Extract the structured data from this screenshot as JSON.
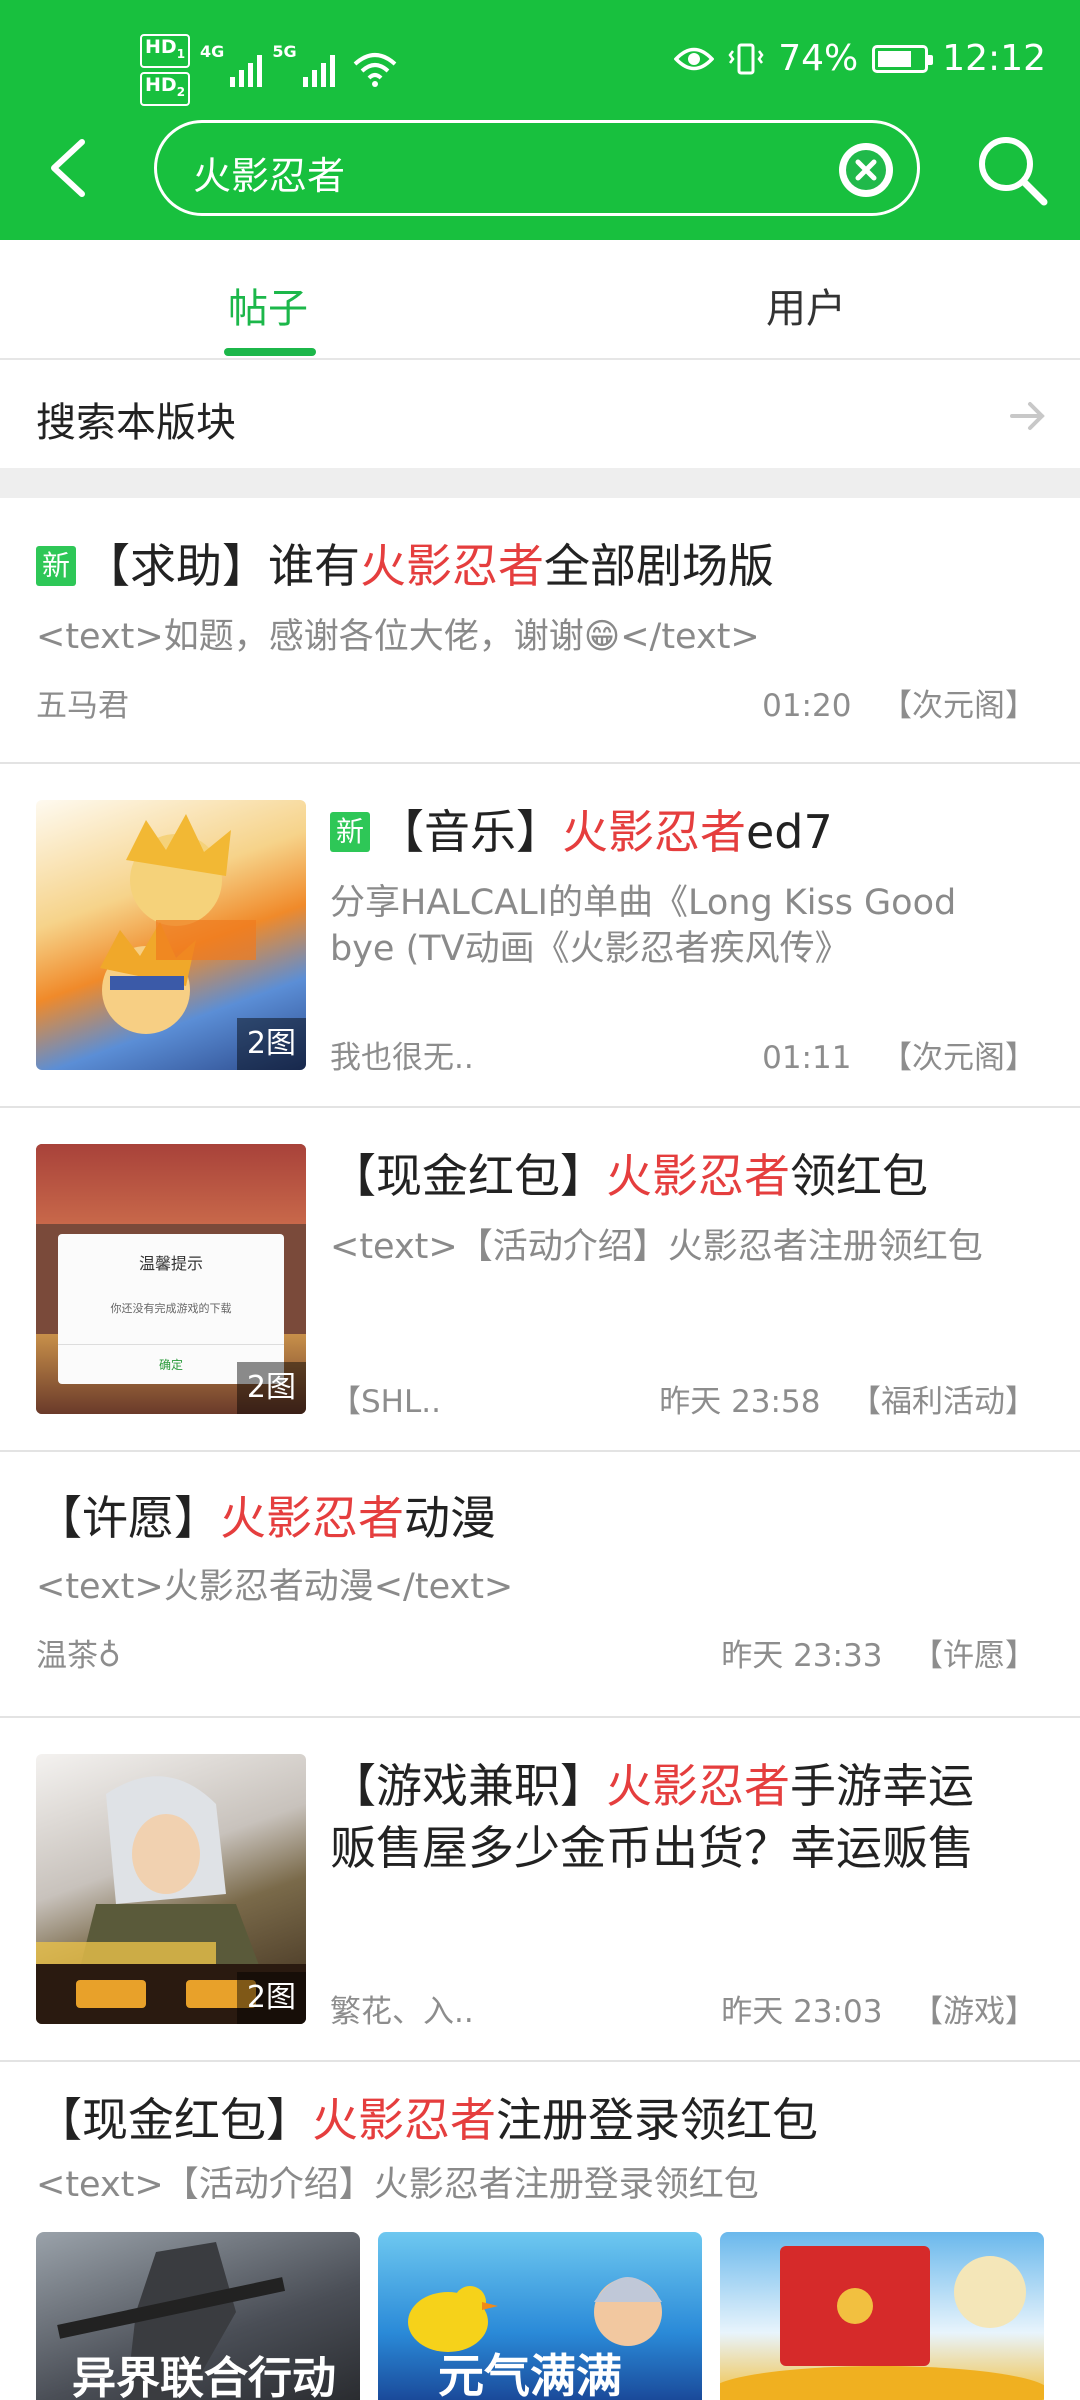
{
  "status_bar": {
    "hd1": "HD",
    "sim1": "1",
    "hd2": "HD",
    "sim2": "2",
    "net1": "4G",
    "net2": "5G",
    "battery_percent": "74%",
    "battery_level": 0.74,
    "time": "12:12"
  },
  "header": {
    "search_query": "火影忍者",
    "accent_color": "#18c03e"
  },
  "tabs": [
    "帖子",
    "用户"
  ],
  "section": {
    "label": "搜索本版块"
  },
  "highlight_color": "#e53e3e",
  "new_badge": "新",
  "posts": [
    {
      "title_pre": "【求助】谁有",
      "title_hl": "火影忍者",
      "title_post": "全部剧场版",
      "snippet": "<text>如题，感谢各位大佬，谢谢😁</text>",
      "author": "五马君",
      "time": "01:20",
      "board": "【次元阁】"
    },
    {
      "title_pre": "【音乐】",
      "title_hl": "火影忍者",
      "title_post": "ed7",
      "snippet_line1": "分享HALCALI的单曲《Long Kiss Good",
      "snippet_line2": "bye (TV动画《火影忍者疾风传》",
      "images": "2图",
      "author": "我也很无..",
      "time": "01:11",
      "board": "【次元阁】"
    },
    {
      "title_pre": "【现金红包】",
      "title_hl": "火影忍者",
      "title_post": "领红包",
      "snippet": "<text>【活动介绍】火影忍者注册领红包",
      "images": "2图",
      "dialog_title": "温馨提示",
      "dialog_text": "你还没有完成游戏的下载",
      "dialog_button": "确定",
      "author": "【SHL..",
      "time": "昨天 23:58",
      "board": "【福利活动】"
    },
    {
      "title_pre": "【许愿】",
      "title_hl": "火影忍者",
      "title_post": "动漫",
      "snippet": "<text>火影忍者动漫</text>",
      "author": "温茶♁",
      "time": "昨天 23:33",
      "board": "【许愿】"
    },
    {
      "title_pre": "【游戏兼职】",
      "title_hl": "火影忍者",
      "title_post": "手游幸运",
      "title_line2": "贩售屋多少金币出货？幸运贩售",
      "images": "2图",
      "author": "繁花、入..",
      "time": "昨天 23:03",
      "board": "【游戏】"
    },
    {
      "title_pre": "【现金红包】",
      "title_hl": "火影忍者",
      "title_post": "注册登录领红包",
      "snippet": "<text>【活动介绍】火影忍者注册登录领红包",
      "mini_texts": [
        "异界联合行动",
        "元气满满"
      ]
    }
  ]
}
